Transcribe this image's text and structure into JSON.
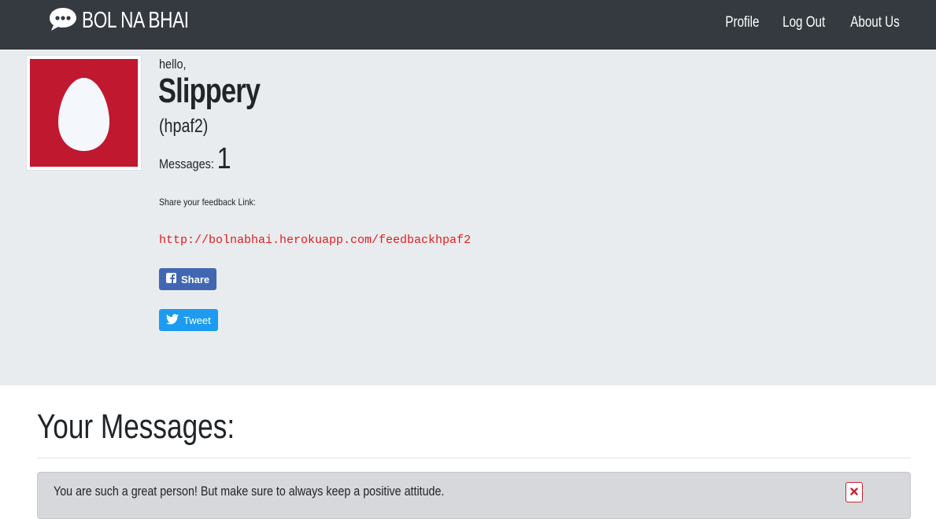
{
  "navbar": {
    "brand": "BOL NA BHAI",
    "brand_icon": "speech-bubble-icon",
    "links": [
      "Profile",
      "Log Out",
      "About Us"
    ]
  },
  "profile": {
    "greeting": "hello,",
    "name": "Slippery",
    "handle": "(hpaf2)",
    "messages_label": "Messages:",
    "messages_count": "1",
    "share_label": "Share your feedback Link:",
    "share_link": "http://bolnabhai.herokuapp.com/feedbackhpaf2",
    "facebook_button": "Share",
    "twitter_button": "Tweet",
    "avatar_icon": "egg-avatar-icon"
  },
  "messages": {
    "title": "Your Messages:",
    "items": [
      {
        "text": "You are such a great person! But make sure to always keep a positive attitude."
      }
    ],
    "delete_icon": "close-icon"
  },
  "colors": {
    "navbar": "#343a40",
    "jumbotron": "#e9ecef",
    "avatar_bg": "#c0182f",
    "link": "#e01d1d",
    "facebook": "#4267b2",
    "twitter": "#1d9bf0",
    "danger": "#c82333"
  }
}
